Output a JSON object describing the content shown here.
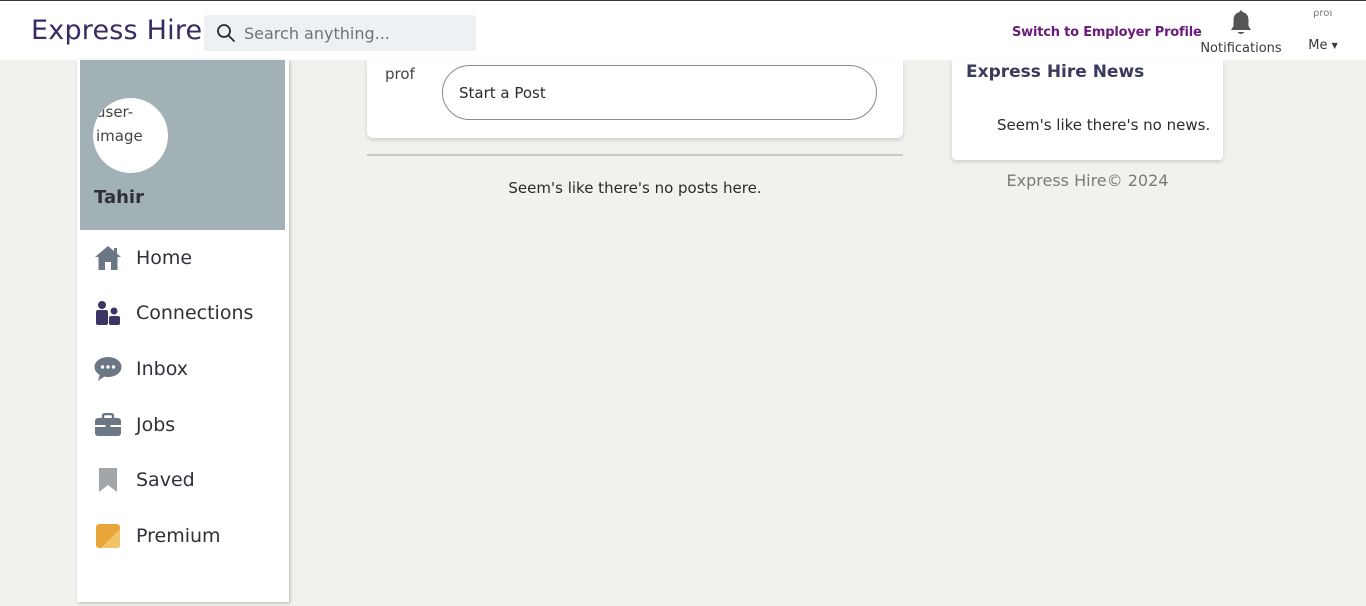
{
  "header": {
    "brand": "Express Hire",
    "search_placeholder": "Search anything...",
    "switch_profile": "Switch to Employer Profile",
    "notifications_label": "Notifications",
    "me_label": "Me",
    "me_avatar_alt": "prof"
  },
  "profile": {
    "avatar_alt": "user-image",
    "name": "Tahir"
  },
  "nav": {
    "items": [
      {
        "label": "Home",
        "icon": "home-icon"
      },
      {
        "label": "Connections",
        "icon": "connections-icon"
      },
      {
        "label": "Inbox",
        "icon": "inbox-icon"
      },
      {
        "label": "Jobs",
        "icon": "briefcase-icon"
      },
      {
        "label": "Saved",
        "icon": "bookmark-icon"
      },
      {
        "label": "Premium",
        "icon": "premium-icon"
      }
    ]
  },
  "feed": {
    "avatar_alt": "prof",
    "start_post": "Start a Post",
    "empty": "Seem's like there's no posts here."
  },
  "news": {
    "title": "Express Hire News",
    "empty": "Seem's like there's no news."
  },
  "footer": {
    "text": "Express Hire© 2024"
  },
  "colors": {
    "brand": "#3a2a62",
    "switch_link": "#6a1a7a",
    "cover": "#a1b1b5",
    "background": "#f2f1ee"
  }
}
